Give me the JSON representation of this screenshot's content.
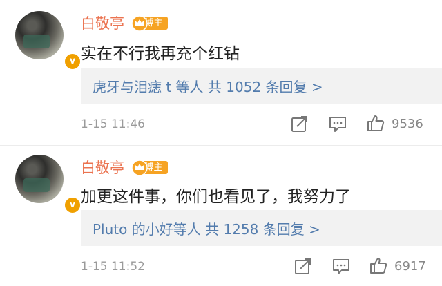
{
  "badge_label": "博主",
  "comments": [
    {
      "user": "白敬亭",
      "verified_mark": "v",
      "text": "实在不行我再充个红钻",
      "reply_summary": "虎牙与泪痣 t 等人 共 1052 条回复 >",
      "time": "1-15 11:46",
      "likes": "9536"
    },
    {
      "user": "白敬亭",
      "verified_mark": "v",
      "text": "加更这件事，你们也看见了，我努力了",
      "reply_summary": "Pluto 的小好等人 共 1258 条回复 >",
      "time": "1-15 11:52",
      "likes": "6917"
    }
  ],
  "icons": {
    "share": "share-icon",
    "comment": "comment-icon",
    "like": "thumbs-up-icon",
    "crown": "crown-icon"
  },
  "colors": {
    "username": "#eb7350",
    "badge": "#f6a323",
    "reply_link": "#537cad",
    "reply_bg": "#f2f2f2",
    "verified": "#f0a000"
  }
}
